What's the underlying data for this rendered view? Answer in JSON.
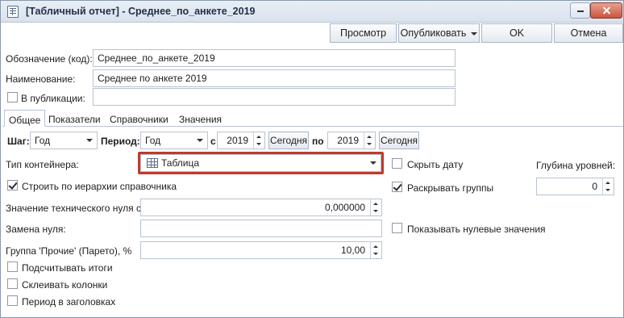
{
  "window": {
    "title": "[Табличный отчет] - Среднее_по_анкете_2019"
  },
  "toolbar": {
    "preview_label": "Просмотр",
    "publish_label": "Опубликовать",
    "ok_label": "OK",
    "cancel_label": "Отмена"
  },
  "form": {
    "code_label": "Обозначение (код):",
    "code_value": "Среднее_по_анкете_2019",
    "name_label": "Наименование:",
    "name_value": "Среднее по анкете 2019",
    "publication_label": "В публикации:",
    "publication_value": ""
  },
  "tabs": [
    {
      "label": "Общее",
      "active": true
    },
    {
      "label": "Показатели",
      "active": false
    },
    {
      "label": "Справочники",
      "active": false
    },
    {
      "label": "Значения",
      "active": false
    }
  ],
  "general": {
    "step_label": "Шаг:",
    "step_value": "Год",
    "period_label": "Период:",
    "period_value": "Год",
    "from_label": "с",
    "from_value": "2019",
    "today_label": "Сегодня",
    "to_label": "по",
    "to_value": "2019",
    "today2_label": "Сегодня",
    "container_label": "Тип контейнера:",
    "container_value": "Таблица",
    "hierarchy_label": "Строить по иерархии справочника",
    "hierarchy_checked": true,
    "tech_zero_label": "Значение технического нуля с",
    "tech_zero_value": "0,000000",
    "replace_zero_label": "Замена нуля:",
    "replace_zero_value": "",
    "other_group_label": "Группа 'Прочие' (Парето), %",
    "other_group_value": "10,00",
    "totals_label": "Подсчитывать итоги",
    "merge_columns_label": "Склеивать колонки",
    "period_headers_label": "Период в заголовках",
    "hide_date_label": "Скрыть дату",
    "expand_groups_label": "Раскрывать группы",
    "expand_groups_checked": true,
    "show_zero_label": "Показывать нулевые значения",
    "depth_label": "Глубина уровней:",
    "depth_value": "0"
  },
  "colors": {
    "highlight": "#c0392b",
    "titlebar": "#dfe6ef"
  }
}
